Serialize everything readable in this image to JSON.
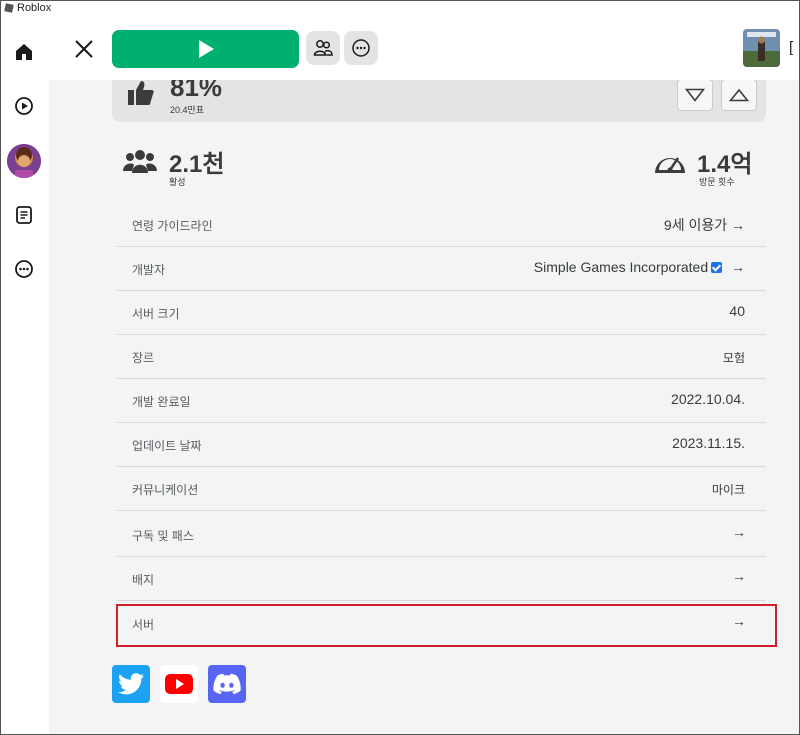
{
  "window": {
    "title": "Roblox"
  },
  "topbar": {
    "cut_label": "["
  },
  "vote": {
    "percent": "81%",
    "count": "20.4만표"
  },
  "stats": {
    "active_value": "2.1천",
    "active_label": "활성",
    "visits_value": "1.4억",
    "visits_label": "방문 횟수"
  },
  "details": [
    {
      "label": "연령 가이드라인",
      "value": "9세 이용가 →"
    },
    {
      "label": "개발자",
      "value": "Simple Games Incorporated"
    },
    {
      "label": "서버 크기",
      "value": "40"
    },
    {
      "label": "장르",
      "value": "모험"
    },
    {
      "label": "개발 완료일",
      "value": "2022.10.04."
    },
    {
      "label": "업데이트 날짜",
      "value": "2023.11.15."
    },
    {
      "label": "커뮤니케이션",
      "value": "마이크"
    },
    {
      "label": "구독 및 패스",
      "value": "→"
    },
    {
      "label": "배지",
      "value": "→"
    },
    {
      "label": "서버",
      "value": "→"
    }
  ],
  "developer_arrow": "→",
  "colors": {
    "play_green": "#00b06f",
    "highlight_red": "#d0202a",
    "twitter": "#1da1f2",
    "youtube": "#ff0000",
    "discord": "#5865f2"
  },
  "icons": [
    "home-icon",
    "play-circle-icon",
    "avatar",
    "notes-icon",
    "more-icon",
    "close-icon",
    "play-icon",
    "group-icon",
    "ellipsis-icon",
    "thumbs-up-icon",
    "thumbs-down-icon",
    "chevron-up-icon",
    "people-icon",
    "speedometer-icon",
    "twitter-icon",
    "youtube-icon",
    "discord-icon"
  ]
}
